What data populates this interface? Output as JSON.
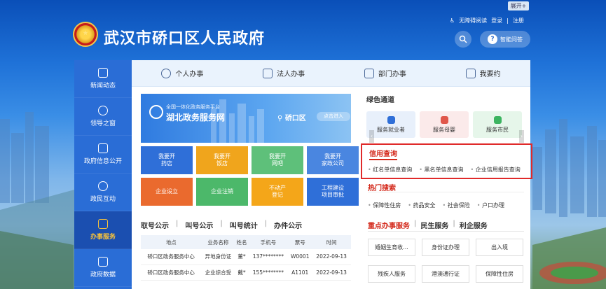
{
  "header": {
    "expand_label": "展开",
    "site_title": "武汉市硚口区人民政府",
    "accessibility_label": "无障碍阅读",
    "login_label": "登录",
    "register_label": "注册",
    "ai_label": "智能问答"
  },
  "sidebar": {
    "items": [
      {
        "label": "新闻动态"
      },
      {
        "label": "领导之窗"
      },
      {
        "label": "政府信息公开"
      },
      {
        "label": "政民互动"
      },
      {
        "label": "办事服务"
      },
      {
        "label": "政府数据"
      }
    ],
    "active_index": 4
  },
  "tabs": [
    {
      "label": "个人办事"
    },
    {
      "label": "法人办事"
    },
    {
      "label": "部门办事"
    },
    {
      "label": "我要约"
    }
  ],
  "banner": {
    "line1": "全国一体化政务服务平台",
    "line2": "湖北政务服务网",
    "location": "硚口区",
    "enter": "点击进入"
  },
  "services": [
    {
      "label": "我要开\n药店",
      "color": "#2f6fd8"
    },
    {
      "label": "我要开\n饭店",
      "color": "#f0a51c"
    },
    {
      "label": "我要开\n网吧",
      "color": "#5ec07a"
    },
    {
      "label": "我要开\n家政公司",
      "color": "#4a86e0"
    },
    {
      "label": "企业设立",
      "color": "#ea6a2e"
    },
    {
      "label": "企业注销",
      "color": "#4cb86a"
    },
    {
      "label": "不动产\n登记",
      "color": "#f4a619"
    },
    {
      "label": "工程建设\n项目审批",
      "color": "#2f6fd8"
    }
  ],
  "queue": {
    "tabs": [
      "取号公示",
      "叫号公示",
      "叫号统计",
      "办件公示"
    ],
    "columns": [
      "地点",
      "业务名称",
      "姓名",
      "手机号",
      "票号",
      "时间"
    ],
    "rows": [
      [
        "硚口区政务服务中心",
        "异地身份证",
        "董*",
        "137********",
        "W0001",
        "2022-09-13"
      ],
      [
        "硚口区政务服务中心",
        "企业综合受",
        "戴*",
        "155********",
        "A1101",
        "2022-09-13"
      ]
    ]
  },
  "green_channel": {
    "title": "绿色通道",
    "cards": [
      {
        "label": "服务就业者",
        "icon": "briefcase-icon",
        "bg": "#e8f0fb",
        "icon_color": "#2f6fd8"
      },
      {
        "label": "服务母婴",
        "icon": "baby-icon",
        "bg": "#fbeaea",
        "icon_color": "#e0564a"
      },
      {
        "label": "服务市民",
        "icon": "citizen-icon",
        "bg": "#e6f6ea",
        "icon_color": "#3cb460"
      }
    ]
  },
  "credit": {
    "title": "信用查询",
    "links": [
      "红名单信息查询",
      "黑名单信息查询",
      "企业信用报告查询"
    ]
  },
  "hot_search": {
    "title": "热门搜索",
    "links": [
      "保障性住房",
      "药品安全",
      "社会保险",
      "户口办理"
    ]
  },
  "key_services": {
    "tabs": [
      "重点办事服务",
      "民生服务",
      "利企服务"
    ],
    "buttons": [
      "婚姻生育收...",
      "身份证办理",
      "出入境",
      "残疾人服务",
      "港澳通行证",
      "保障性住房"
    ]
  }
}
